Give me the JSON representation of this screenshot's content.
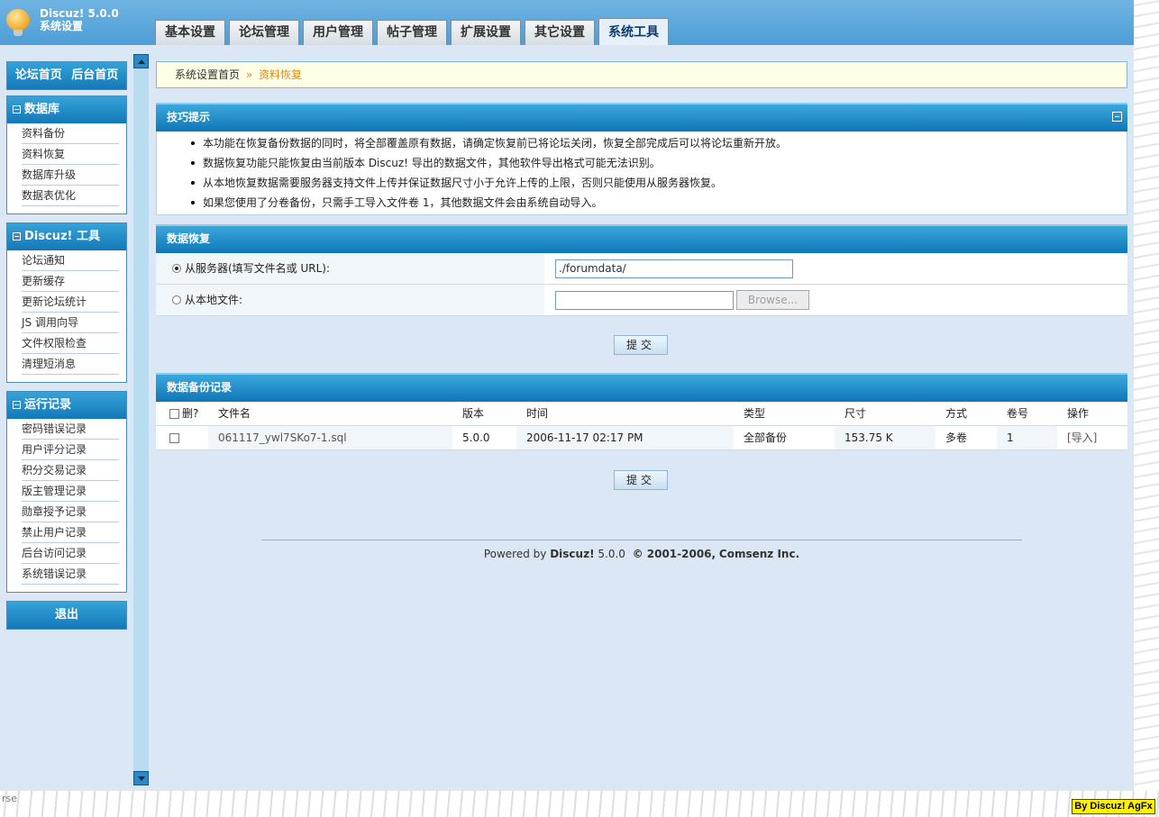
{
  "header": {
    "app_name": "Discuz! 5.0.0",
    "section": "系统设置",
    "tabs": [
      {
        "label": "基本设置",
        "active": false
      },
      {
        "label": "论坛管理",
        "active": false
      },
      {
        "label": "用户管理",
        "active": false
      },
      {
        "label": "帖子管理",
        "active": false
      },
      {
        "label": "扩展设置",
        "active": false
      },
      {
        "label": "其它设置",
        "active": false
      },
      {
        "label": "系统工具",
        "active": true
      }
    ]
  },
  "sidebar": {
    "top_links": [
      "论坛首页",
      "后台首页"
    ],
    "groups": [
      {
        "title": "数据库",
        "items": [
          "资料备份",
          "资料恢复",
          "数据库升级",
          "数据表优化"
        ]
      },
      {
        "title": "Discuz! 工具",
        "items": [
          "论坛通知",
          "更新缓存",
          "更新论坛统计",
          "JS 调用向导",
          "文件权限检查",
          "清理短消息"
        ]
      },
      {
        "title": "运行记录",
        "items": [
          "密码错误记录",
          "用户评分记录",
          "积分交易记录",
          "版主管理记录",
          "勋章授予记录",
          "禁止用户记录",
          "后台访问记录",
          "系统错误记录"
        ]
      }
    ],
    "logout": "退出"
  },
  "breadcrumb": {
    "home": "系统设置首页",
    "separator": "»",
    "current": "资料恢复"
  },
  "tips": {
    "title": "技巧提示",
    "items": [
      "本功能在恢复备份数据的同时，将全部覆盖原有数据，请确定恢复前已将论坛关闭，恢复全部完成后可以将论坛重新开放。",
      "数据恢复功能只能恢复由当前版本 Discuz! 导出的数据文件，其他软件导出格式可能无法识别。",
      "从本地恢复数据需要服务器支持文件上传并保证数据尺寸小于允许上传的上限，否则只能使用从服务器恢复。",
      "如果您使用了分卷备份，只需手工导入文件卷 1，其他数据文件会由系统自动导入。"
    ]
  },
  "restore": {
    "title": "数据恢复",
    "server_label": "从服务器(填写文件名或 URL):",
    "server_value": "./forumdata/",
    "local_label": "从本地文件:",
    "browse_label": "Browse...",
    "submit_label": "提交"
  },
  "backups": {
    "title": "数据备份记录",
    "columns": [
      "删?",
      "文件名",
      "版本",
      "时间",
      "类型",
      "尺寸",
      "方式",
      "卷号",
      "操作"
    ],
    "rows": [
      {
        "file": "061117_ywl7SKo7-1.sql",
        "version": "5.0.0",
        "time": "2006-11-17 02:17 PM",
        "type": "全部备份",
        "size": "153.75 K",
        "method": "多卷",
        "volume": "1",
        "action": "[导入]"
      }
    ],
    "submit_label": "提交"
  },
  "footer": {
    "powered": "Powered by",
    "brand": "Discuz!",
    "version": "5.0.0",
    "copyright": "© 2001-2006,",
    "company": "Comsenz Inc."
  },
  "status_bar": {
    "text": "rse"
  },
  "watermark": "By Discuz! AgFx",
  "colors": {
    "header_blue": "#4e9dd6",
    "panel_head": "#1478b8",
    "breadcrumb_bg": "#ffffe6",
    "accent_orange": "#e4870c"
  }
}
